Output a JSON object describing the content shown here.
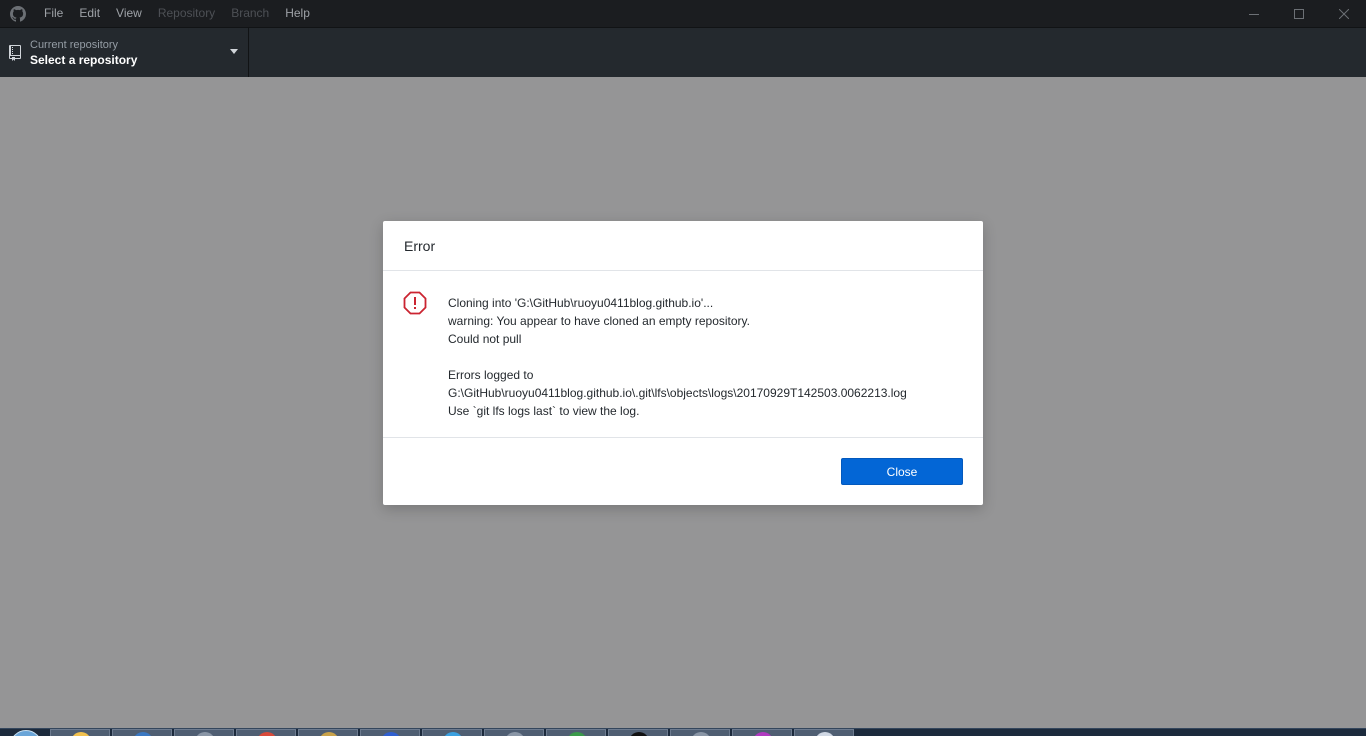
{
  "menu": {
    "items": [
      {
        "label": "File",
        "enabled": true
      },
      {
        "label": "Edit",
        "enabled": true
      },
      {
        "label": "View",
        "enabled": true
      },
      {
        "label": "Repository",
        "enabled": false
      },
      {
        "label": "Branch",
        "enabled": false
      },
      {
        "label": "Help",
        "enabled": true
      }
    ]
  },
  "toolbar": {
    "repo_caption": "Current repository",
    "repo_title": "Select a repository"
  },
  "dialog": {
    "title": "Error",
    "lines": [
      "Cloning into 'G:\\GitHub\\ruoyu0411blog.github.io'...",
      "warning: You appear to have cloned an empty repository.",
      "Could not pull",
      "",
      "Errors logged to",
      "G:\\GitHub\\ruoyu0411blog.github.io\\.git\\lfs\\objects\\logs\\20170929T142503.0062213.log",
      "Use `git lfs logs last` to view the log."
    ],
    "close_label": "Close"
  },
  "taskbar": {
    "apps": [
      {
        "icon": "explorer-icon",
        "color": "#f2c14e"
      },
      {
        "icon": "app-icon",
        "color": "#3a78c2"
      },
      {
        "icon": "app-icon",
        "color": "#8a96a6"
      },
      {
        "icon": "chrome-icon",
        "color": "#d94a3a"
      },
      {
        "icon": "app-icon",
        "color": "#c9a24a"
      },
      {
        "icon": "app-icon",
        "color": "#2f5fd0"
      },
      {
        "icon": "app-icon",
        "color": "#3aa0e0"
      },
      {
        "icon": "app-icon",
        "color": "#8a96a6"
      },
      {
        "icon": "app-icon",
        "color": "#3a9a4a"
      },
      {
        "icon": "terminal-icon",
        "color": "#111111"
      },
      {
        "icon": "app-icon",
        "color": "#8a96a6"
      },
      {
        "icon": "app-icon",
        "color": "#b03ac0"
      },
      {
        "icon": "app-icon",
        "color": "#d0d8e4"
      }
    ]
  }
}
